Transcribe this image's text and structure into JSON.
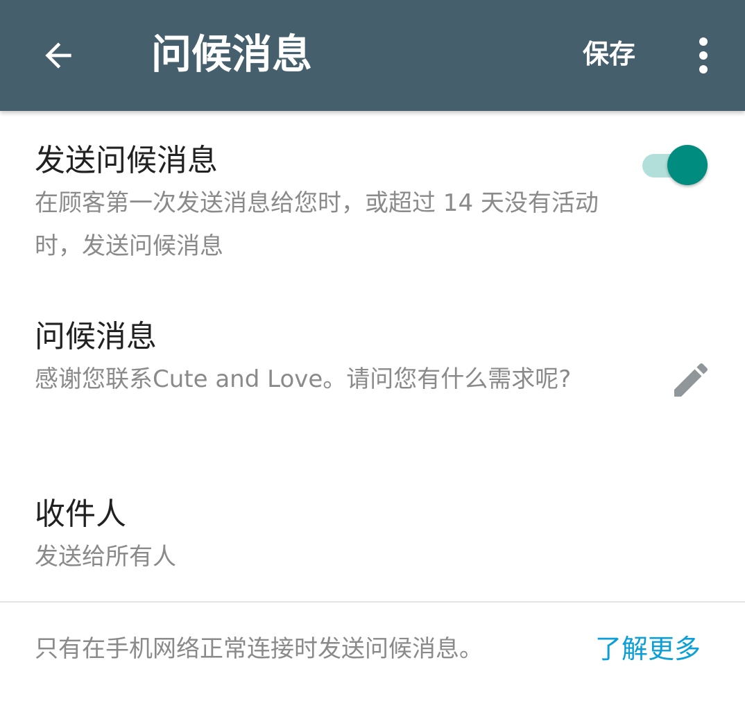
{
  "appbar": {
    "title": "问候消息",
    "save_label": "保存",
    "back_icon": "arrow-back-icon",
    "overflow_icon": "more-vertical-icon",
    "background_color": "#455f6d"
  },
  "send_greeting": {
    "title": "发送问候消息",
    "description": "在顾客第一次发送消息给您时，或超过 14 天没有活动时，发送问候消息",
    "enabled": true,
    "switch_color": "#008c7e"
  },
  "greeting_message": {
    "title": "问候消息",
    "message": "感谢您联系Cute and Love。请问您有什么需求呢?",
    "edit_icon": "pencil-icon"
  },
  "recipients": {
    "title": "收件人",
    "value": "发送给所有人"
  },
  "footer": {
    "note": "只有在手机网络正常连接时发送问候消息。",
    "learn_more_label": "了解更多",
    "link_color": "#0a9fd8"
  }
}
